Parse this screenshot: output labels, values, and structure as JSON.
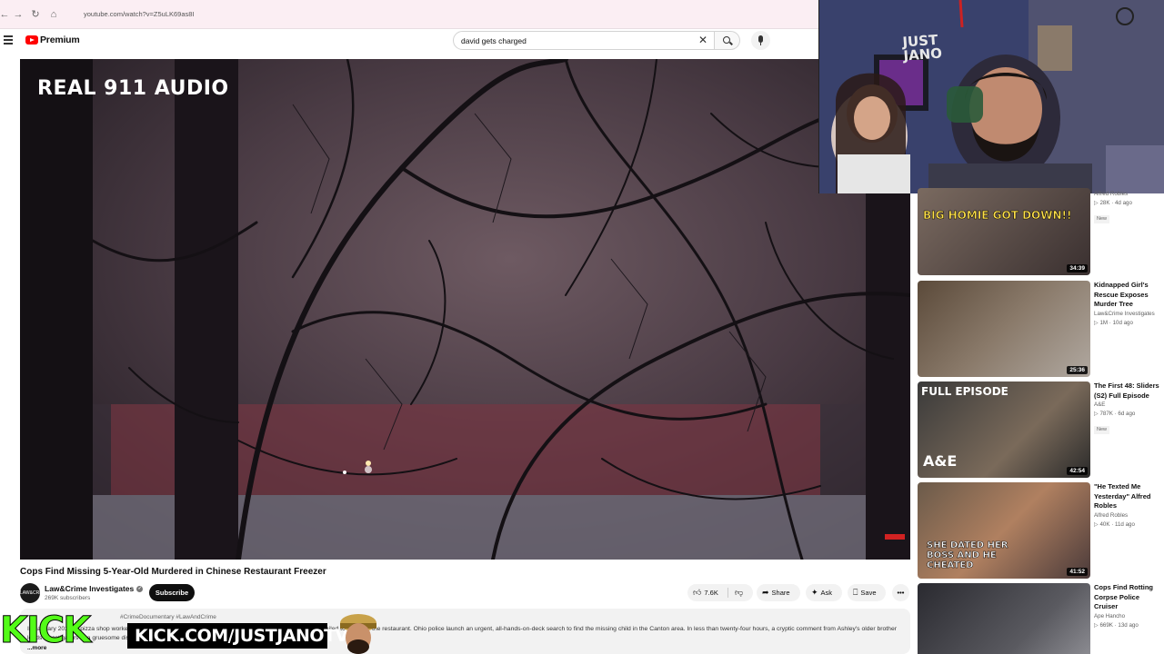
{
  "browser": {
    "url": "youtube.com/watch?v=Z5uLK69as8I",
    "back_icon": "arrow-left-icon",
    "forward_icon": "arrow-right-icon",
    "reload_icon": "reload-icon",
    "home_icon": "home-icon"
  },
  "header": {
    "logo_text": "Premium",
    "search_value": "david gets charged",
    "clear_symbol": "✕"
  },
  "player": {
    "overlay_text": "REAL 911 AUDIO"
  },
  "video": {
    "title": "Cops Find Missing 5-Year-Old Murdered in Chinese Restaurant Freezer",
    "channel": "Law&Crime Investigates",
    "subscribers": "269K subscribers",
    "subscribe_label": "Subscribe",
    "likes": "7.6K",
    "share_label": "Share",
    "ask_label": "Ask",
    "save_label": "Save",
    "more_symbol": "•••",
    "avatar_text": "LAW&CRIME"
  },
  "description": {
    "tags": "#CrimeDocumentary #LawAndCrime",
    "text": "In January 2017, a pizza shop worker, Hang Zhou, made a disturbing discovery when this five-year-old child failed to return to the restaurant. Ohio police launch an urgent, all-hands-on-deck search to find the missing child in the Canton area. In less than twenty-four hours, a cryptic comment from Ashley's older brother leads investigators to a gruesome discovery. In this episode of Law&Crime Investigates.",
    "more_label": "...more"
  },
  "stream_overlay": {
    "kick_logo": "KICK",
    "kick_url": "KICK.COM/JUSTJANOTV",
    "cam_sign": "JUST\nJANO"
  },
  "sidebar": {
    "items": [
      {
        "title": "",
        "channel": "Alfred Robles",
        "meta": "▷ 28K · 4d ago",
        "badge": "New",
        "duration": "34:39",
        "thumb_text": "BIG HOMIE GOT DOWN!!"
      },
      {
        "title": "Kidnapped Girl's Rescue Exposes Murder Tree",
        "channel": "Law&Crime Investigates",
        "meta": "▷ 1M · 10d ago",
        "badge": "",
        "duration": "25:36",
        "thumb_text": ""
      },
      {
        "title": "The First 48: Sliders (S2) Full Episode",
        "channel": "A&E",
        "meta": "▷ 787K · 6d ago",
        "badge": "New",
        "duration": "42:54",
        "thumb_text": "FULL EPISODE"
      },
      {
        "title": "\"He Texted Me Yesterday\" Alfred Robles",
        "channel": "Alfred Robles",
        "meta": "▷ 40K · 11d ago",
        "badge": "",
        "duration": "41:52",
        "thumb_text": "SHE DATED HER BOSS AND HE CHEATED"
      },
      {
        "title": "Cops Find Rotting Corpse Police Cruiser",
        "channel": "Ape Hancho",
        "meta": "▷ 669K · 13d ago",
        "badge": "",
        "duration": "",
        "thumb_text": ""
      }
    ]
  },
  "colors": {
    "accent": "#ff0000",
    "kick_green": "#53fc18"
  }
}
